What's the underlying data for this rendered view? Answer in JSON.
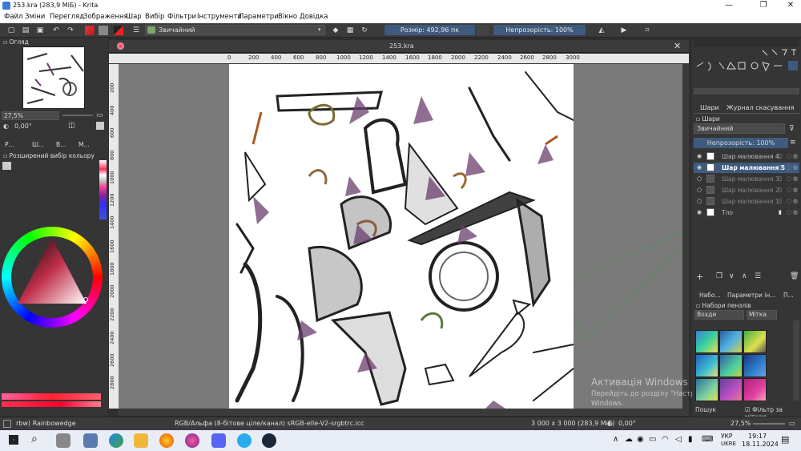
{
  "window": {
    "title": "253.kra (283,9 МіБ) - Krita"
  },
  "menu": [
    "Файл",
    "Зміни",
    "Перегляд",
    "Зображення",
    "Шар",
    "Вибір",
    "Фільтри",
    "Інструменти",
    "Параметри",
    "Вікно",
    "Довідка"
  ],
  "toolbar": {
    "blend_mode": "Звичайний",
    "size_label": "Розмір: 492,96 пк",
    "opacity_label": "Непрозорість: 100%"
  },
  "left_panel": {
    "overview_title": "Огляд",
    "zoom_value": "27,5%",
    "rotation_value": "0,00°",
    "tabs": [
      "Р...",
      "Ш...",
      "В...",
      "М..."
    ],
    "color_selector_title": "Розширений вибір кольору"
  },
  "document": {
    "tab_title": "253.kra",
    "ruler_h": [
      "0",
      "200",
      "400",
      "600",
      "800",
      "1000",
      "1200",
      "1400",
      "1600",
      "1800",
      "2000",
      "2200",
      "2400",
      "2600",
      "2800",
      "3000"
    ],
    "ruler_v": [
      "200",
      "400",
      "600",
      "800",
      "1000",
      "1200",
      "1400",
      "1600",
      "1800",
      "2000",
      "2200",
      "2400",
      "2600",
      "2800"
    ]
  },
  "right_panel": {
    "tabs": [
      "Шари",
      "Журнал скасування"
    ],
    "layers_title": "Шари",
    "blend_mode": "Звичайний",
    "opacity": "Непрозорість: 100%",
    "layers": [
      {
        "name": "Шар малювання 4",
        "active": false,
        "visible": true
      },
      {
        "name": "Шар малювання 5",
        "active": true,
        "visible": true
      },
      {
        "name": "Шар малювання 3",
        "active": false,
        "visible": false
      },
      {
        "name": "Шар малювання 2",
        "active": false,
        "visible": false
      },
      {
        "name": "Шар малювання 1",
        "active": false,
        "visible": false
      },
      {
        "name": "Тло",
        "active": false,
        "visible": true
      }
    ],
    "brush_tabs": [
      "Набо...",
      "Параметри ін...",
      "П..."
    ],
    "brush_presets_title": "Набори пензлів",
    "brush_filter": "Вохди",
    "brush_tag": "Мітка",
    "search_label": "Пошук",
    "filter_by_tag": "Фільтр за міткою"
  },
  "statusbar": {
    "brush": "rbw) Rainbowedge",
    "colorspace": "RGB/Альфа (8-бітове ціле/канал)  sRGB-elle-V2-srgbtrc.icc",
    "dimensions": "3 000 x 3 000 (283,9 МіБ)",
    "rotation": "0,00°",
    "zoom": "27,5%"
  },
  "watermark": {
    "line1": "Активація Windows",
    "line2": "Перейдіть до розділу \"Настройки\", щоб активувати",
    "line3": "Windows."
  },
  "taskbar": {
    "lang1": "УКР",
    "lang2": "UKRE",
    "time": "19:17",
    "date": "18.11.2024"
  }
}
